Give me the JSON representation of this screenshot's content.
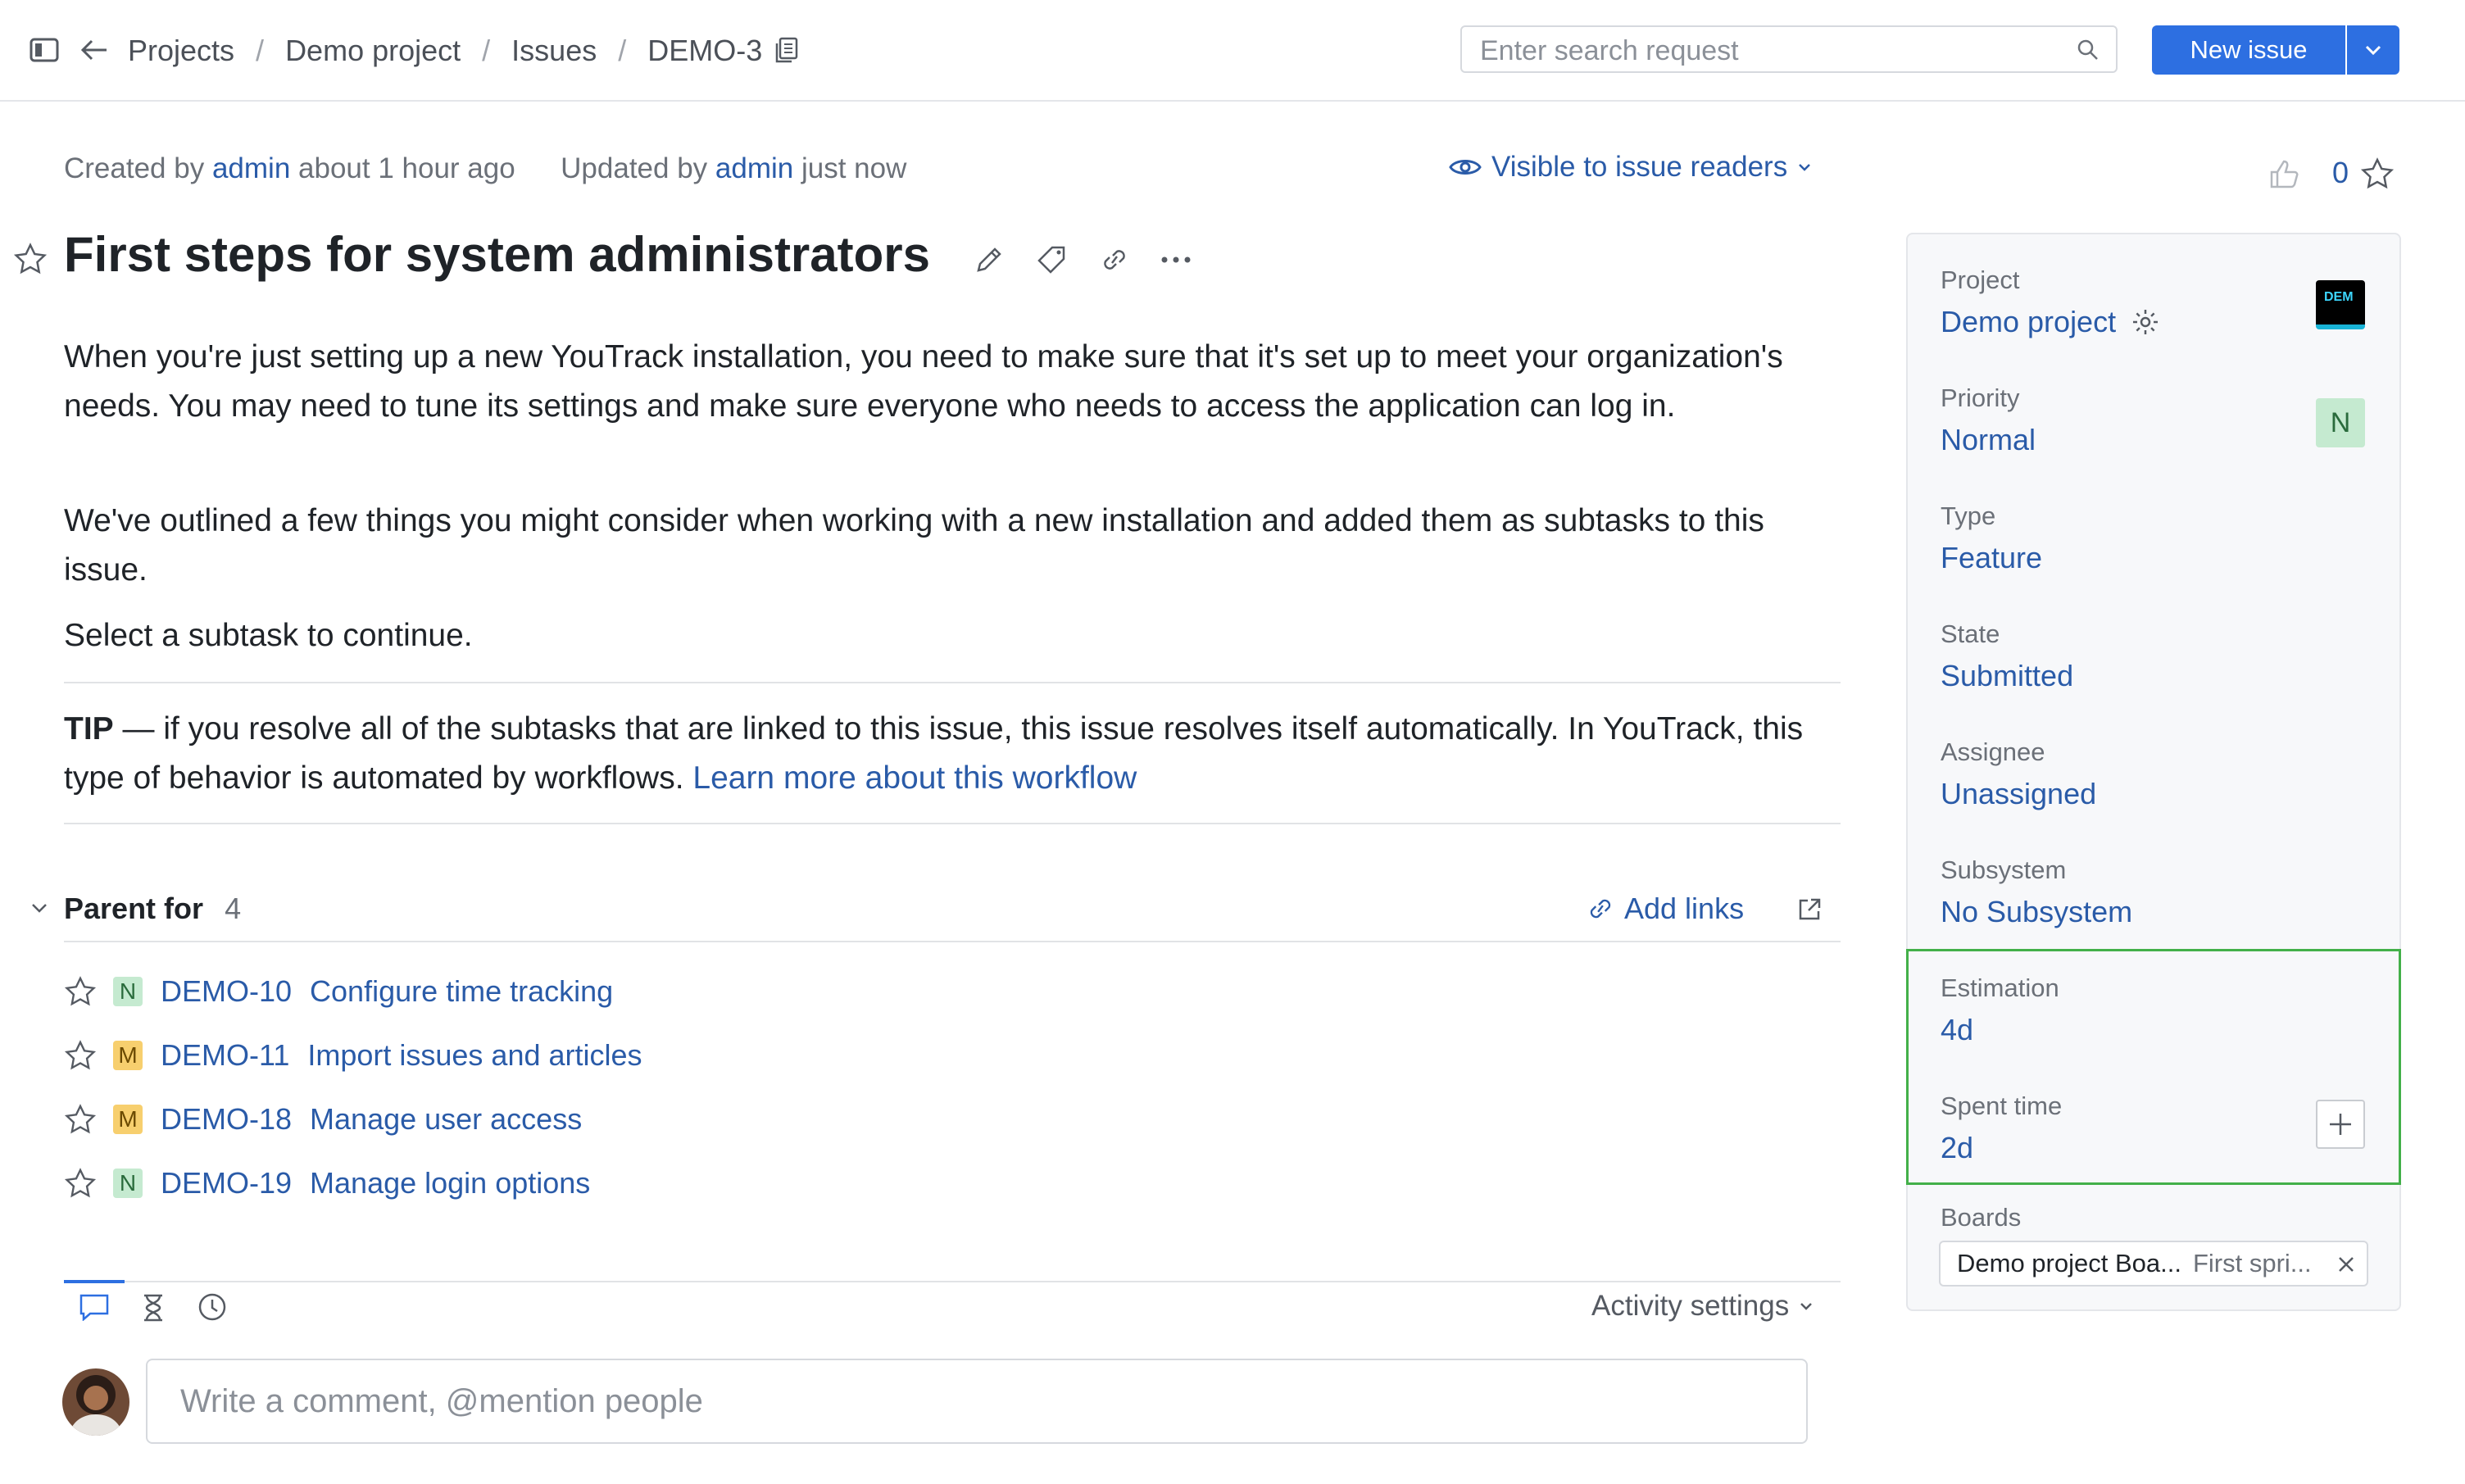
{
  "breadcrumb": [
    "Projects",
    "Demo project",
    "Issues",
    "DEMO-3"
  ],
  "search": {
    "placeholder": "Enter search request"
  },
  "new_issue_label": "New issue",
  "meta": {
    "created_prefix": "Created by",
    "created_user": "admin",
    "created_time": "about 1 hour ago",
    "updated_prefix": "Updated by",
    "updated_user": "admin",
    "updated_time": "just now"
  },
  "visibility": "Visible to issue readers",
  "votes": "0",
  "issue": {
    "title": "First steps for system administrators",
    "p1": "When you're just setting up a new YouTrack installation, you need to make sure that it's set up to meet your organization's needs. You may need to tune its settings and make sure everyone who needs to access the application can log in.",
    "p2": "We've outlined a few things you might consider when working with a new installation and added them as subtasks to this issue.",
    "p3": "Select a subtask to continue.",
    "tip_label": "TIP",
    "tip_text": " — if you resolve all of the subtasks that are linked to this issue, this issue resolves itself automatically. In YouTrack, this type of behavior is automated by workflows. ",
    "tip_link": "Learn more about this workflow"
  },
  "parent_for": {
    "label": "Parent for",
    "count": "4",
    "add_links": "Add links",
    "items": [
      {
        "priority": "N",
        "id": "DEMO-10",
        "summary": "Configure time tracking"
      },
      {
        "priority": "M",
        "id": "DEMO-11",
        "summary": "Import issues and articles"
      },
      {
        "priority": "M",
        "id": "DEMO-18",
        "summary": "Manage user access"
      },
      {
        "priority": "N",
        "id": "DEMO-19",
        "summary": "Manage login options"
      }
    ]
  },
  "activity_settings": "Activity settings",
  "comment": {
    "placeholder": "Write a comment, @mention people"
  },
  "fields": {
    "project": {
      "label": "Project",
      "value": "Demo project",
      "logo_text": "DEM"
    },
    "priority": {
      "label": "Priority",
      "value": "Normal",
      "badge": "N"
    },
    "type": {
      "label": "Type",
      "value": "Feature"
    },
    "state": {
      "label": "State",
      "value": "Submitted"
    },
    "assignee": {
      "label": "Assignee",
      "value": "Unassigned"
    },
    "subsystem": {
      "label": "Subsystem",
      "value": "No Subsystem"
    },
    "estimation": {
      "label": "Estimation",
      "value": "4d"
    },
    "spent_time": {
      "label": "Spent time",
      "value": "2d"
    },
    "boards": {
      "label": "Boards",
      "board": "Demo project Boa...",
      "sprint": "First spri..."
    }
  },
  "colors": {
    "accent": "#2d6fe1",
    "link": "#2a5ba8",
    "highlight_border": "#43b049"
  }
}
